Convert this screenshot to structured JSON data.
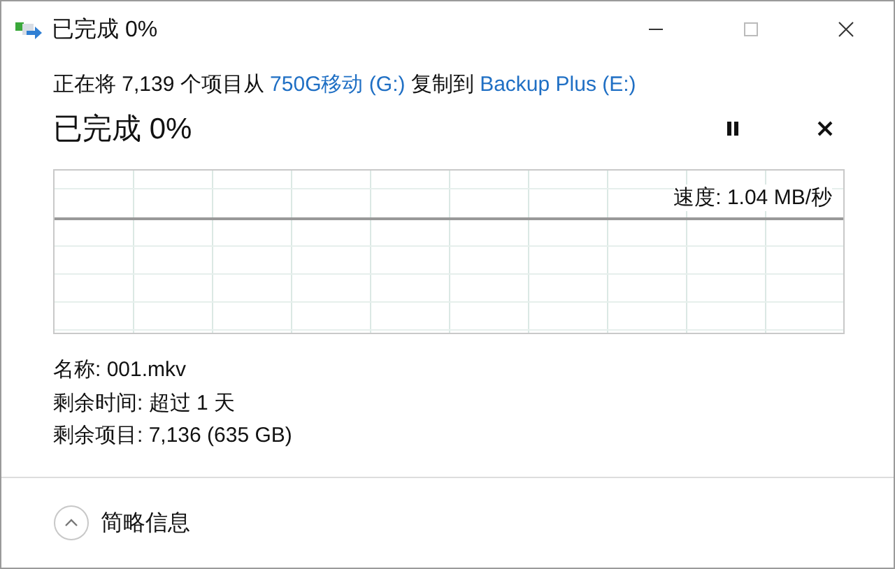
{
  "window": {
    "title": "已完成 0%"
  },
  "summary": [
    {
      "kind": "text",
      "text": "正在将 7,139 个项目从 "
    },
    {
      "kind": "link",
      "text": "750G移动 (G:)"
    },
    {
      "kind": "text",
      "text": " 复制到 "
    },
    {
      "kind": "link",
      "text": "Backup Plus (E:)"
    }
  ],
  "progress_heading": "已完成 0%",
  "speed": "速度: 1.04 MB/秒",
  "details": [
    "名称: 001.mkv",
    "剩余时间: 超过 1 天",
    "剩余项目: 7,136 (635 GB)"
  ],
  "footer": {
    "toggle": "简略信息",
    "expanded": true
  }
}
